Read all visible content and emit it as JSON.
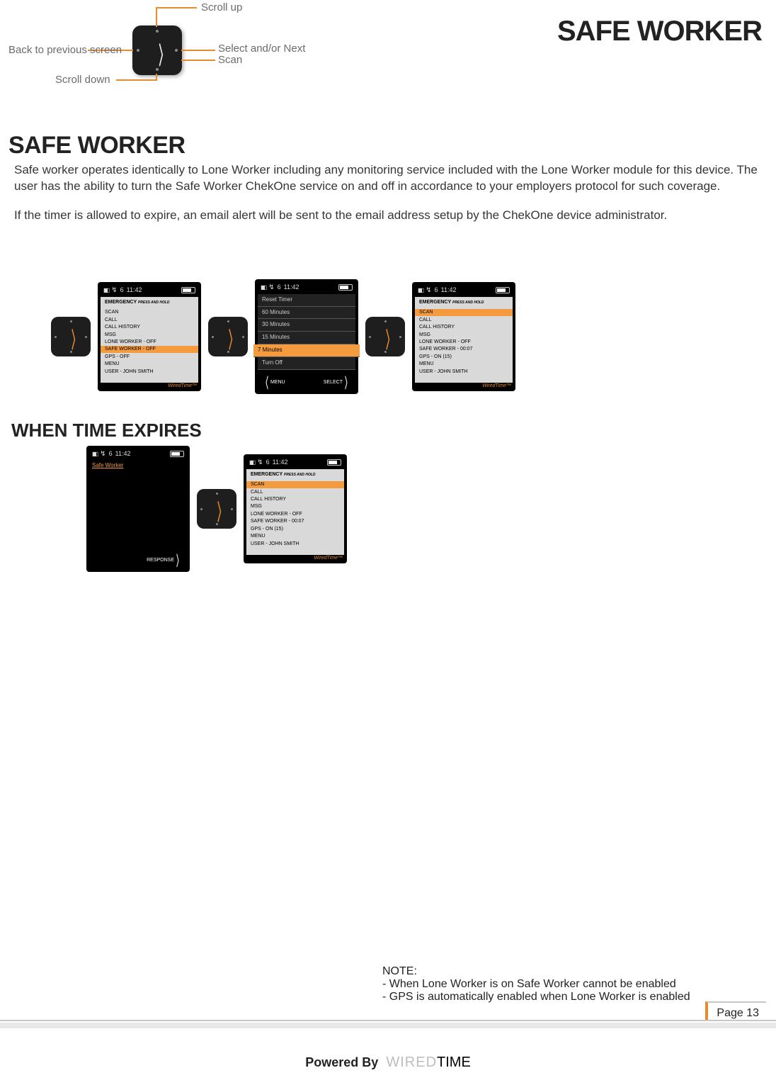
{
  "header": {
    "page_title": "SAFE WORKER"
  },
  "nav_diagram": {
    "scroll_up": "Scroll up",
    "scroll_down": "Scroll down",
    "back": "Back to previous screen",
    "select": "Select and/or Next",
    "scan": "Scan"
  },
  "section": {
    "title": "SAFE WORKER",
    "p1": "Safe worker operates identically to Lone Worker including any monitoring service included with the Lone Worker module for this device. The user has the ability to turn the Safe Worker ChekOne service on and off in accordance to your employers protocol for such coverage.",
    "p2": "If the timer is allowed to expire, an email alert will be sent to the email address setup by the ChekOne device administrator."
  },
  "status": {
    "sig_num": "6",
    "time": "11:42"
  },
  "emergency_label": "EMERGENCY",
  "emergency_sub": "PRESS AND HOLD",
  "brand": "WiredTime™",
  "device1": {
    "items": [
      "SCAN",
      "CALL",
      "CALL HISTORY",
      "MSG",
      "LONE WORKER - OFF",
      "SAFE WORKER - OFF",
      "GPS - OFF",
      "MENU",
      "USER - JOHN SMITH"
    ],
    "highlight": "SAFE WORKER - OFF"
  },
  "device2": {
    "items": [
      "Reset Timer",
      "60 Minutes",
      "30 Minutes",
      "15 Minutes",
      "7 Minutes",
      "Turn Off"
    ],
    "highlight": "7 Minutes",
    "btn_left": "MENU",
    "btn_right": "SELECT"
  },
  "device3": {
    "items": [
      "SCAN",
      "CALL",
      "CALL HISTORY",
      "MSG",
      "LONE WORKER - OFF",
      "SAFE WORKER - 00:07",
      "GPS - ON (15)",
      "MENU",
      "USER - JOHN SMITH"
    ],
    "highlight": "SCAN"
  },
  "subhead": "WHEN TIME EXPIRES",
  "device4": {
    "title": "Safe Worker",
    "btn_right": "RESPONSE"
  },
  "device5": {
    "items": [
      "SCAN",
      "CALL",
      "CALL HISTORY",
      "MSG",
      "LONE WORKER - OFF",
      "SAFE WORKER - 00:07",
      "GPS - ON (15)",
      "MENU",
      "USER - JOHN SMITH"
    ],
    "highlight": "SCAN"
  },
  "note": {
    "title": "NOTE:",
    "l1": "- When Lone Worker is on Safe Worker cannot be enabled",
    "l2": "- GPS is automatically enabled when Lone Worker is enabled"
  },
  "page_num": "Page 13",
  "powered": {
    "label": "Powered By",
    "w": "WIRED",
    "t": "TIME"
  }
}
